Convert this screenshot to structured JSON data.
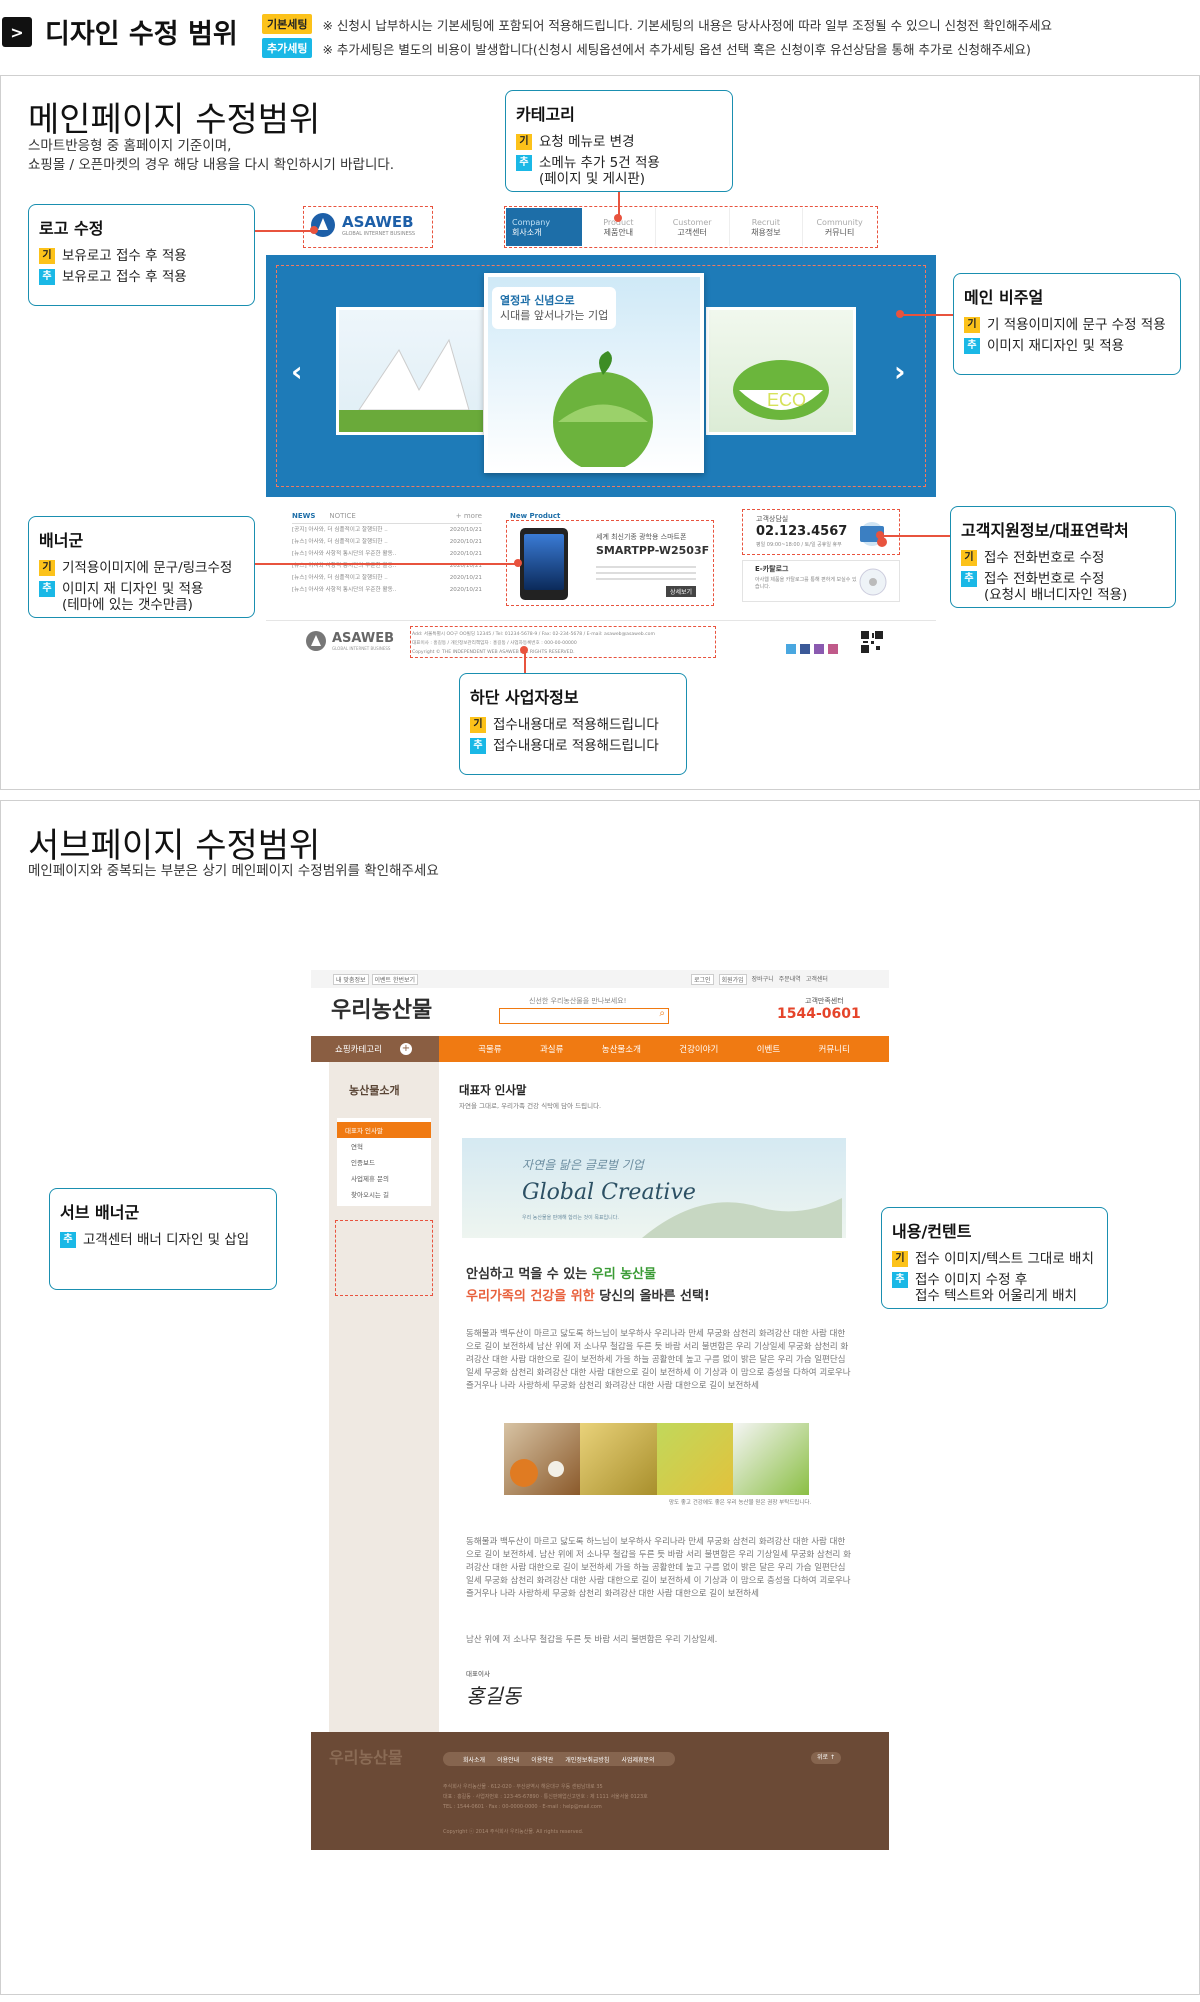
{
  "header": {
    "arrow": ">",
    "title": "디자인 수정 범위",
    "tags": [
      {
        "label": "기본세팅",
        "text": "※ 신청시 납부하시는 기본세팅에 포함되어 적용해드립니다. 기본세팅의 내용은 당사사정에 따라 일부 조정될 수 있으니 신청전 확인해주세요"
      },
      {
        "label": "추가세팅",
        "text": "※ 추가세팅은 별도의 비용이 발생합니다(신청시 세팅옵션에서 추가세팅 옵션 선택 혹은 신청이후 유선상담을 통해 추가로 신청해주세요)"
      }
    ]
  },
  "badges": {
    "basic": "기",
    "extra": "추"
  },
  "main_section": {
    "title": "메인페이지 수정범위",
    "desc1": "스마트반응형 중 홈페이지 기준이며,",
    "desc2": "쇼핑몰 / 오픈마켓의 경우 해당 내용을 다시 확인하시기 바랍니다."
  },
  "callouts": {
    "category": {
      "title": "카테고리",
      "basic": "요청 메뉴로 변경",
      "extra1": "소메뉴 추가 5건 적용",
      "extra2": "(페이지 및 게시판)"
    },
    "logo": {
      "title": "로고 수정",
      "basic": "보유로고 접수 후 적용",
      "extra": "보유로고 접수 후 적용"
    },
    "visual": {
      "title": "메인 비주얼",
      "basic": "기 적용이미지에 문구 수정 적용",
      "extra": "이미지 재디자인 및 적용"
    },
    "banner": {
      "title": "배너군",
      "basic": "기적용이미지에 문구/링크수정",
      "extra1": "이미지 재 디자인 및 적용",
      "extra2": "(테마에 있는 갯수만큼)"
    },
    "cs": {
      "title": "고객지원정보/대표연락처",
      "basic": "접수 전화번호로 수정",
      "extra1": "접수 전화번호로 수정",
      "extra2": "(요청시 배너디자인 적용)"
    },
    "footer": {
      "title": "하단 사업자정보",
      "basic": "접수내용대로 적용해드립니다",
      "extra": "접수내용대로 적용해드립니다"
    },
    "subbanner": {
      "title": "서브 배너군",
      "extra": "고객센터 배너 디자인 및 삽입"
    },
    "content": {
      "title": "내용/컨텐트",
      "basic": "접수 이미지/텍스트 그대로 배치",
      "extra1": "접수 이미지 수정 후",
      "extra2": "접수 텍스트와 어울리게 배치"
    }
  },
  "mock_main": {
    "logo": "ASAWEB",
    "logo_sub": "GLOBAL INTERNET BUSINESS",
    "nav": [
      {
        "en": "Company",
        "ko": "회사소개"
      },
      {
        "en": "Product",
        "ko": "제품안내"
      },
      {
        "en": "Customer",
        "ko": "고객센터"
      },
      {
        "en": "Recruit",
        "ko": "채용정보"
      },
      {
        "en": "Community",
        "ko": "커뮤니티"
      }
    ],
    "slogan1": "열정과 신념으로",
    "slogan2": "시대를 앞서나가는 기업",
    "news_tab": "NEWS",
    "notice_tab": "NOTICE",
    "more": "+ more",
    "news": [
      {
        "t": "[공지] 아사와, 더 심플적이고 잘행되한 ..",
        "d": "2020/10/21"
      },
      {
        "t": "[뉴스] 아사와, 더 심플적이고 잘행되한 ..",
        "d": "2020/10/21"
      },
      {
        "t": "[뉴스] 아사와 사항적 통시단의 우준한 활동..",
        "d": "2020/10/21"
      },
      {
        "t": "[뉴스] 아사와 사항적 통시단의 우준한 활동..",
        "d": "2020/10/21"
      },
      {
        "t": "[뉴스] 아사와, 더 심플적이고 잘행되한 ..",
        "d": "2020/10/21"
      },
      {
        "t": "[뉴스] 아사와 사항적 통시단의 우준한 활동..",
        "d": "2020/10/21"
      }
    ],
    "new_product": "New Product",
    "product_line": "세계 최신기종 광학용 스마트폰",
    "product_name": "SMARTPP-W2503F",
    "product_btn": "상세보기",
    "cs_label": "고객상담실",
    "cs_phone": "02.123.4567",
    "cs_hours": "평일 09:00~18:00 / 토/일 공휴일 휴무",
    "email_label": "E-카탈로그",
    "email_desc": "아사웹 제품을 카탈로그를 통해 편하게 보실수 있습니다.",
    "footer_line1": "Add: 서울특별시 OO구 OO빌딩 12345 / Tel: 01234-5678-9 / Fax: 02-234-5678 / E-mail: asaweb@asaweb.com",
    "footer_line2": "대표이사 : 홍길동 / 개인정보관리책임자 : 홍길동 / 사업자등록번호 : 000-00-00000",
    "footer_line3": "Copyright © THE INDEPENDENT WEB ASAWEB ALL RIGHTS RESERVED."
  },
  "sub_section": {
    "title": "서브페이지 수정범위",
    "desc": "메인페이지와 중복되는 부분은 상기 메인페이지 수정범위를 확인해주세요"
  },
  "mock_sub": {
    "top_links_left": [
      "내 맞춤정보",
      "이벤트 한번보기"
    ],
    "top_links_right": [
      "로그인",
      "회원가입",
      "장바구니",
      "주문내역",
      "고객센터"
    ],
    "logo": "우리농산물",
    "search_hint": "신선한 우리농산물을 만나보세요!",
    "cs_label": "고객만족센터",
    "cs_phone": "1544-0601",
    "category_btn": "쇼핑카테고리",
    "menu": [
      "곡물류",
      "과실류",
      "농산물소개",
      "건강이야기",
      "이벤트",
      "커뮤니티"
    ],
    "side_title": "농산물소개",
    "side_items": [
      "대표자 인사말",
      "연혁",
      "인증보드",
      "사업제휴 문의",
      "찾아오시는 길"
    ],
    "page_title": "대표자 인사말",
    "page_sub": "자연을 그대로, 우리가족 건강 식탁에 담아 드립니다.",
    "banner_script": "자연을 닮은 글로벌 기업",
    "banner_title": "Global Creative",
    "banner_note": "우리 농산물을 판매해 합리는 것이 목표입니다.",
    "head1a": "안심하고 먹을 수 있는",
    "head1b": "우리 농산물",
    "head2a": "우리가족의 건강을 위한",
    "head2b": "당신의 올바른 선택!",
    "para1": "동해물과 백두산이 마르고 닳도록 하느님이 보우하사 우리나라 만세 무궁화 삼천리 화려강산 대한 사람 대한으로 길이 보전하세 남산 위에 저 소나무 철갑을 두른 듯 바람 서리 불변함은 우리 기상일세 무궁화 삼천리 화려강산 대한 사람 대한으로 길이 보전하세 가을 하늘 공활한데 높고 구름 없이 밝은 달은 우리 가슴 일편단심일세 무궁화 삼천리 화려강산 대한 사람 대한으로 길이 보전하세 이 기상과 이 맘으로 충성을 다하여 괴로우나 즐거우나 나라 사랑하세 무궁화 삼천리 화려강산 대한 사람 대한으로 길이 보전하세",
    "img_caption": "망도 좋고 건강에도 좋은 우리 농산물 믿은 권장 부탁드립니다.",
    "para2": "동해물과 백두산이 마르고 닳도록 하느님이 보우하사 우리나라 만세 무궁화 삼천리 화려강산 대한 사람 대한으로 길이 보전하세. 남산 위에 저 소나무 철갑을 두른 듯 바람 서리 불변함은 우리 기상일세 무궁화 삼천리 화려강산 대한 사람 대한으로 길이 보전하세 가을 하늘 공활한데 높고 구름 없이 밝은 달은 우리 가슴 일편단심일세 무궁화 삼천리 화려강산 대한 사람 대한으로 길이 보전하세 이 기상과 이 맘으로 충성을 다하여 괴로우나 즐거우나 나라 사랑하세 무궁화 삼천리 화려강산 대한 사람 대한으로 길이 보전하세",
    "para3": "남산 위에 저 소나무 철갑을 두른 듯 바람 서리 불변함은 우리 기상일세.",
    "sign_label": "대표이사",
    "sign_name": "홍길동",
    "footer_logo": "우리농산물",
    "footer_links": [
      "회사소개",
      "이용안내",
      "이용약관",
      "개인정보취급방침",
      "사업제휴문의"
    ],
    "footer_top": "위로 ↑",
    "footer_addr1": "주식회사 우리농산물 · 612-020 · 부산광역시 해운대구 우동 센텀남대로 35",
    "footer_addr2": "대표 : 홍길동 · 사업자번호 : 123-45-67890 · 통신판매업신고번호 : 제 1111 서울서울 0123호",
    "footer_addr3": "TEL : 1544-0601 · Fax : 00-0000-0000 · E-mail : help@mail.com",
    "footer_copy": "Copyright ⓒ 2014 주식회사 우리농산물. All rights reserved."
  },
  "colors": {
    "accent": "#e8533e",
    "callout_border": "#1a8fb0",
    "basic": "#fcc21a",
    "extra": "#1ab8e6",
    "sub_orange": "#f07a12",
    "sub_brown": "#6b4a36"
  }
}
